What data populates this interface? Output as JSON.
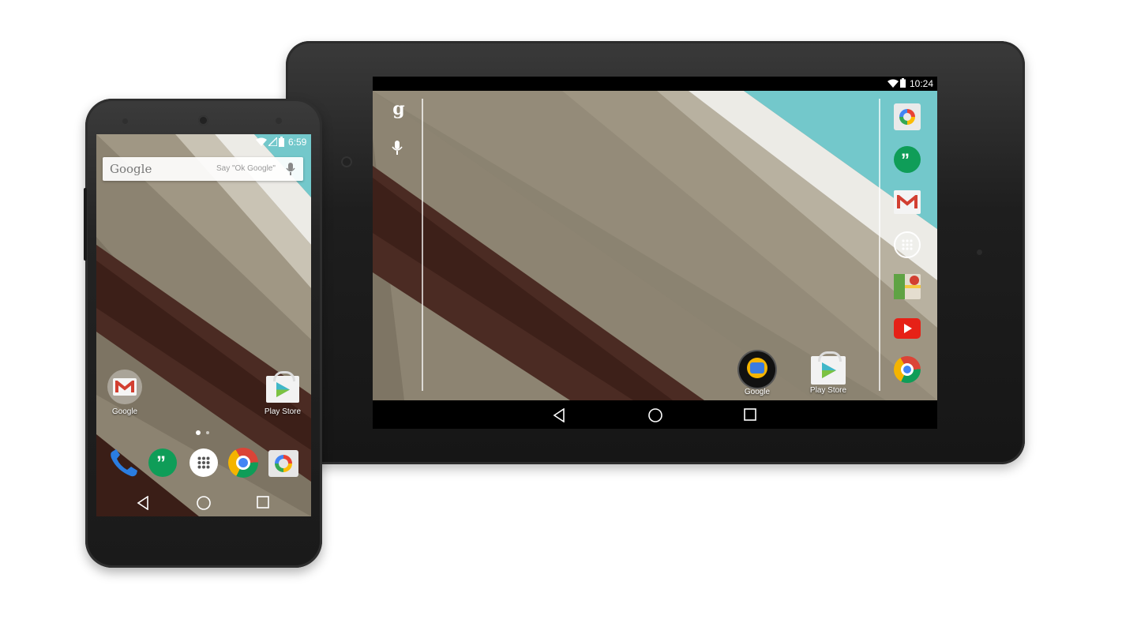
{
  "tablet": {
    "status": {
      "time": "10:24",
      "wifi_icon": "wifi-icon",
      "battery_icon": "battery-icon"
    },
    "left_rail": {
      "search_icon": "google-g-icon",
      "voice_icon": "microphone-icon"
    },
    "desktop_apps": [
      {
        "label": "Google",
        "icon": "google-folder-icon"
      },
      {
        "label": "Play Store",
        "icon": "play-store-icon"
      }
    ],
    "dock": [
      {
        "icon": "camera-icon"
      },
      {
        "icon": "hangouts-icon"
      },
      {
        "icon": "gmail-icon"
      },
      {
        "icon": "app-drawer-icon"
      },
      {
        "icon": "maps-icon"
      },
      {
        "icon": "youtube-icon"
      },
      {
        "icon": "chrome-icon"
      }
    ],
    "nav": {
      "back": "back-icon",
      "home": "home-icon",
      "recents": "recents-icon"
    }
  },
  "phone": {
    "status": {
      "time": "6:59",
      "wifi_icon": "wifi-icon",
      "signal_icon": "signal-icon",
      "battery_icon": "battery-icon"
    },
    "search": {
      "logo": "Google",
      "hint": "Say \"Ok Google\"",
      "mic_icon": "microphone-icon"
    },
    "home_apps": [
      {
        "label": "Google",
        "icon": "gmail-icon"
      },
      {
        "label": "Play Store",
        "icon": "play-store-icon"
      }
    ],
    "page_indicator": {
      "pages": 2,
      "current": 1
    },
    "dock": [
      {
        "icon": "phone-icon"
      },
      {
        "icon": "hangouts-icon"
      },
      {
        "icon": "app-drawer-icon"
      },
      {
        "icon": "chrome-icon"
      },
      {
        "icon": "camera-icon"
      }
    ],
    "nav": {
      "back": "back-icon",
      "home": "home-icon",
      "recents": "recents-icon"
    }
  },
  "colors": {
    "wallpaper_tan": "#8c8371",
    "wallpaper_brown": "#4a2a22",
    "wallpaper_white": "#e8e6e0",
    "wallpaper_teal": "#6ec9cc",
    "hangouts_green": "#0f9d58",
    "youtube_red": "#e62117"
  }
}
